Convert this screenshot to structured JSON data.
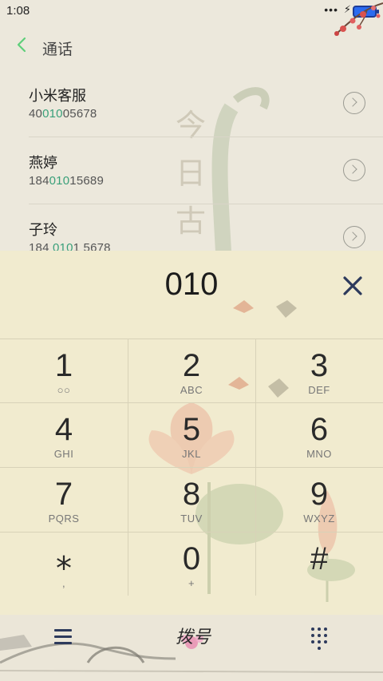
{
  "status_bar": {
    "time": "1:08",
    "dots": "•••",
    "bolt": "⚡"
  },
  "header": {
    "title": "通话"
  },
  "contacts": [
    {
      "name": "小米客服",
      "number_pre": "40",
      "number_match": "010",
      "number_post": "05678"
    },
    {
      "name": "燕婷",
      "number_pre": "184",
      "number_match": "010",
      "number_post": "15689"
    },
    {
      "name": "子玲",
      "number_pre": "184 ",
      "number_match": "010",
      "number_post": "1 5678"
    }
  ],
  "dialer": {
    "input": "010",
    "keys": [
      {
        "digit": "1",
        "letters": "○○"
      },
      {
        "digit": "2",
        "letters": "ABC"
      },
      {
        "digit": "3",
        "letters": "DEF"
      },
      {
        "digit": "4",
        "letters": "GHI"
      },
      {
        "digit": "5",
        "letters": "JKL"
      },
      {
        "digit": "6",
        "letters": "MNO"
      },
      {
        "digit": "7",
        "letters": "PQRS"
      },
      {
        "digit": "8",
        "letters": "TUV"
      },
      {
        "digit": "9",
        "letters": "WXYZ"
      },
      {
        "digit": "⁎",
        "letters": ","
      },
      {
        "digit": "0",
        "letters": "+"
      },
      {
        "digit": "#",
        "letters": ""
      }
    ]
  },
  "bottom_bar": {
    "dial_label": "拨号"
  },
  "colors": {
    "accent_green": "#3aa07a",
    "icon_navy": "#2d3a5c",
    "dialer_bg": "#f1ebcf"
  }
}
